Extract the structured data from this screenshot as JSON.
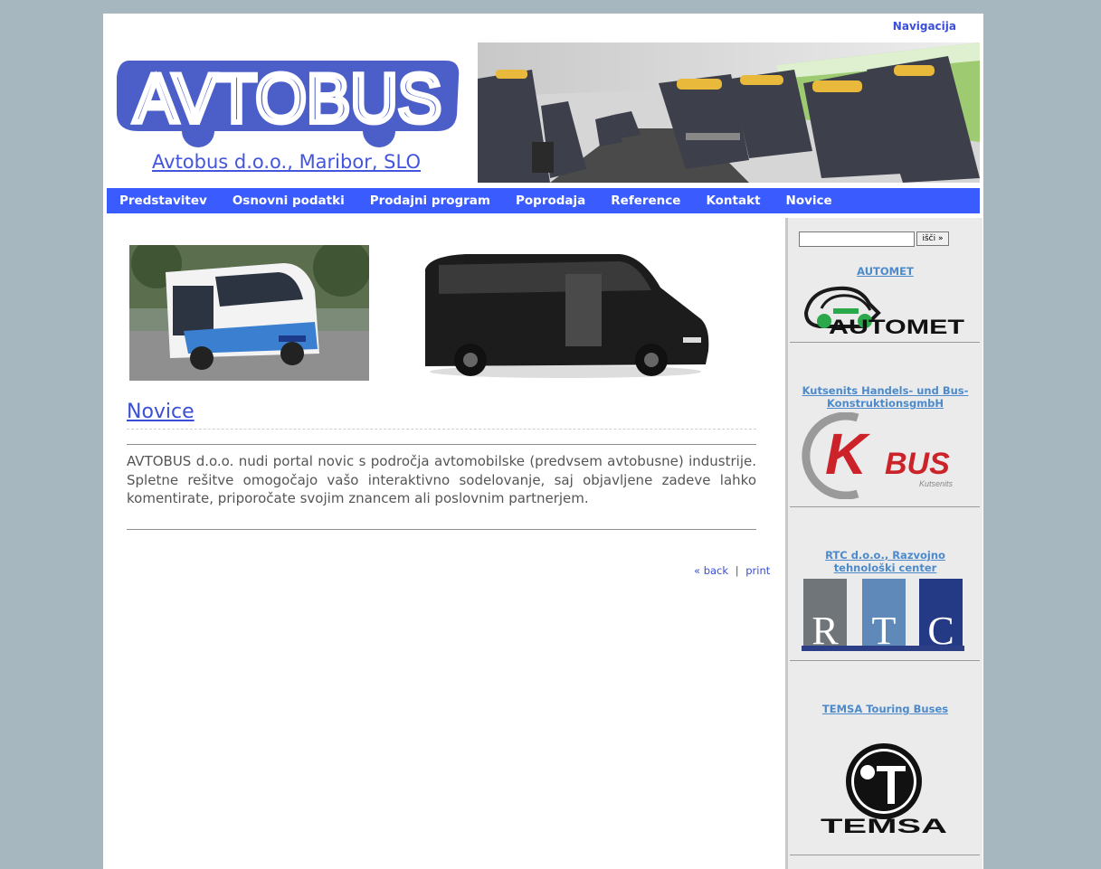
{
  "header": {
    "top_link": "Navigacija",
    "logo_text": "AVTOBUS",
    "company_link": "Avtobus d.o.o., Maribor, SLO"
  },
  "menu": {
    "items": [
      "Predstavitev",
      "Osnovni podatki",
      "Prodajni program",
      "Poprodaja",
      "Reference",
      "Kontakt",
      "Novice"
    ]
  },
  "main": {
    "title": "Novice",
    "body": "AVTOBUS d.o.o. nudi portal novic s področja avtomobilske (predvsem avtobusne) industrije. Spletne rešitve omogočajo vašo interaktivno sodelovanje, saj objavljene zadeve lahko komentirate, priporočate svojim znancem ali poslovnim partnerjem.",
    "back_link": "« back",
    "separator": "|",
    "print_link": "print"
  },
  "sidebar": {
    "search_button": "išči »",
    "partners": [
      {
        "name": "AUTOMET",
        "logo_text": "AUTOMET"
      },
      {
        "name": "Kutsenits Handels- und Bus-KonstruktionsgmbH",
        "logo_text": "BUS",
        "logo_letter": "K",
        "logo_sub": "Kutsenits"
      },
      {
        "name": "RTC d.o.o., Razvojno tehnološki center",
        "logo_letters": [
          "R",
          "T",
          "C"
        ]
      },
      {
        "name": "TEMSA Touring Buses",
        "logo_text": "TEMSA"
      }
    ]
  },
  "colors": {
    "background": "#a7b7bf",
    "menu_bar": "#3a5cff",
    "link": "#3b4fd6",
    "sidebar_link": "#4d8acb",
    "logo_blue": "#4c5fc9"
  }
}
